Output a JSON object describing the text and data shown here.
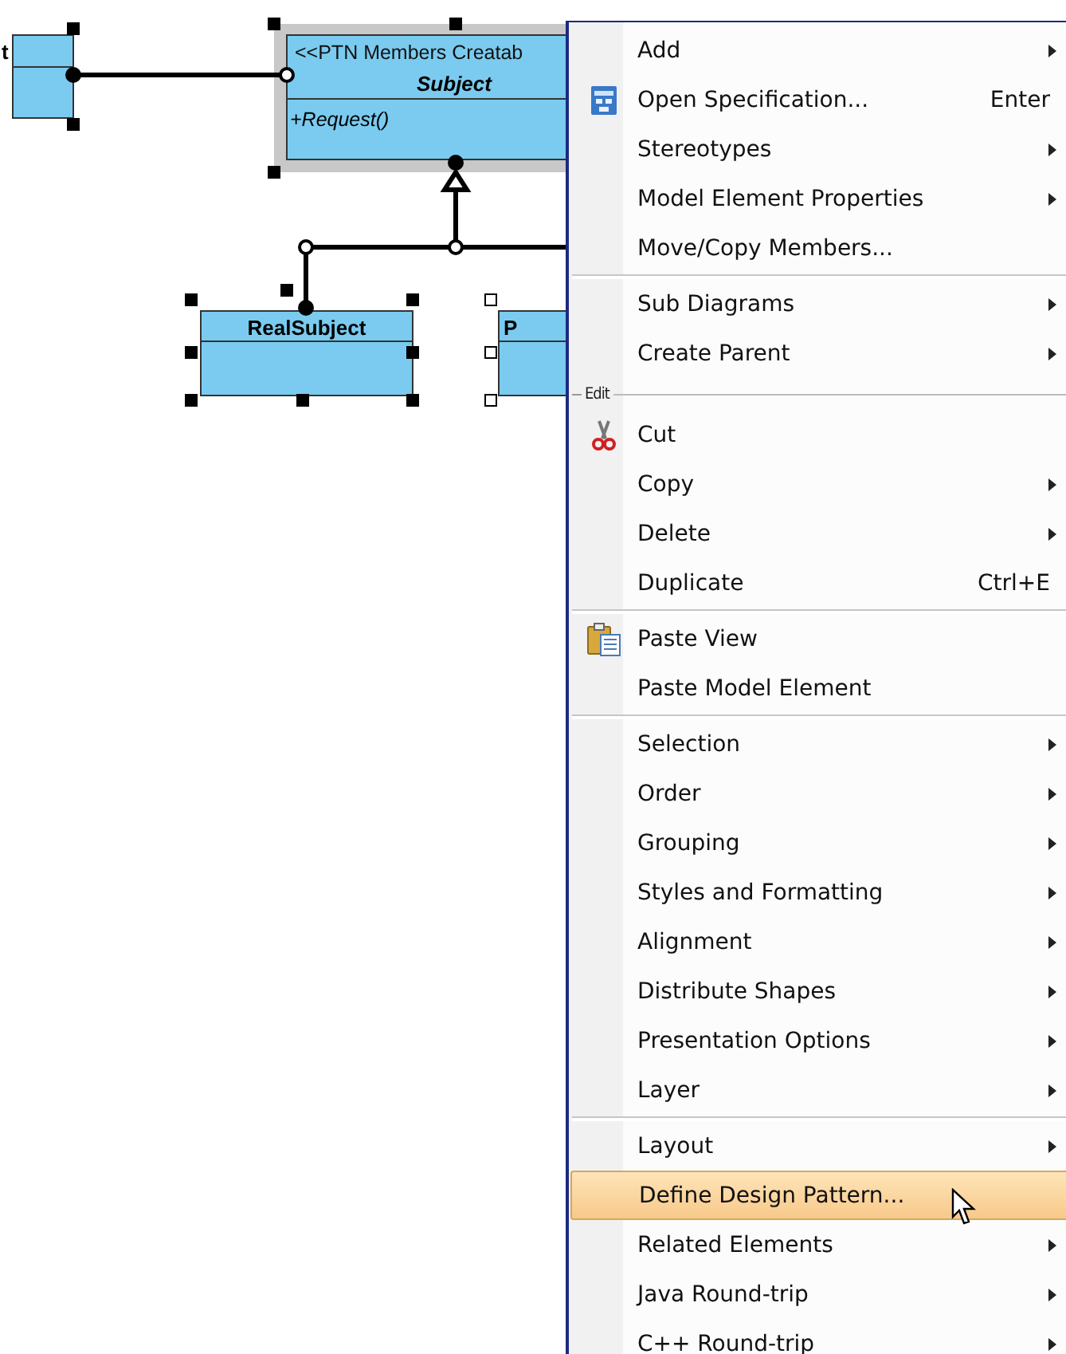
{
  "diagram": {
    "classes": [
      {
        "name": "t",
        "selected": true,
        "highlighted": false
      },
      {
        "stereotype": "<<PTN Members Creatab",
        "name": "Subject",
        "abstract": true,
        "operations": [
          "+Request()"
        ],
        "selected": true,
        "highlighted": true
      },
      {
        "name": "RealSubject",
        "selected": true,
        "highlighted": false
      },
      {
        "name": "P",
        "selected": false,
        "highlighted": false
      }
    ]
  },
  "context_menu": {
    "items": [
      {
        "kind": "item",
        "label": "Add",
        "submenu": true,
        "selected": false
      },
      {
        "kind": "item",
        "label": "Open Specification...",
        "shortcut": "Enter",
        "submenu": false,
        "selected": false
      },
      {
        "kind": "item",
        "label": "Stereotypes",
        "submenu": true,
        "selected": false
      },
      {
        "kind": "item",
        "label": "Model Element Properties",
        "submenu": true,
        "selected": false
      },
      {
        "kind": "item",
        "label": "Move/Copy Members...",
        "submenu": false,
        "selected": false
      },
      {
        "kind": "separator"
      },
      {
        "kind": "item",
        "label": "Sub Diagrams",
        "submenu": true,
        "selected": false
      },
      {
        "kind": "item",
        "label": "Create Parent",
        "submenu": true,
        "selected": false
      },
      {
        "kind": "group",
        "label": "Edit"
      },
      {
        "kind": "item",
        "label": "Cut",
        "submenu": false,
        "selected": false
      },
      {
        "kind": "item",
        "label": "Copy",
        "submenu": true,
        "selected": false
      },
      {
        "kind": "item",
        "label": "Delete",
        "submenu": true,
        "selected": false
      },
      {
        "kind": "item",
        "label": "Duplicate",
        "shortcut": "Ctrl+E",
        "submenu": false,
        "selected": false
      },
      {
        "kind": "separator"
      },
      {
        "kind": "item",
        "label": "Paste View",
        "submenu": false,
        "selected": false
      },
      {
        "kind": "item",
        "label": "Paste Model Element",
        "submenu": false,
        "selected": false
      },
      {
        "kind": "separator"
      },
      {
        "kind": "item",
        "label": "Selection",
        "submenu": true,
        "selected": false
      },
      {
        "kind": "item",
        "label": "Order",
        "submenu": true,
        "selected": false
      },
      {
        "kind": "item",
        "label": "Grouping",
        "submenu": true,
        "selected": false
      },
      {
        "kind": "item",
        "label": "Styles and Formatting",
        "submenu": true,
        "selected": false
      },
      {
        "kind": "item",
        "label": "Alignment",
        "submenu": true,
        "selected": false
      },
      {
        "kind": "item",
        "label": "Distribute Shapes",
        "submenu": true,
        "selected": false
      },
      {
        "kind": "item",
        "label": "Presentation Options",
        "submenu": true,
        "selected": false
      },
      {
        "kind": "item",
        "label": "Layer",
        "submenu": true,
        "selected": false
      },
      {
        "kind": "separator"
      },
      {
        "kind": "item",
        "label": "Layout",
        "submenu": true,
        "selected": false
      },
      {
        "kind": "item",
        "label": "Define Design Pattern...",
        "submenu": false,
        "selected": true
      },
      {
        "kind": "item",
        "label": "Related Elements",
        "submenu": true,
        "selected": false
      },
      {
        "kind": "item",
        "label": "Java Round-trip",
        "submenu": true,
        "selected": false
      },
      {
        "kind": "item",
        "label": "C++ Round-trip",
        "submenu": true,
        "selected": false
      }
    ]
  }
}
